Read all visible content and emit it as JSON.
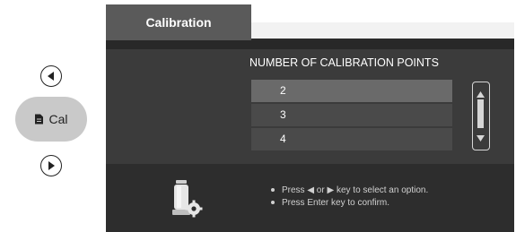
{
  "nav": {
    "prev_icon": "left-arrow-circle-icon",
    "mode_label": "Cal",
    "mode_icon": "document-icon",
    "next_icon": "right-arrow-circle-icon"
  },
  "screen": {
    "title": "Calibration",
    "question": "NUMBER OF CALIBRATION POINTS",
    "options": [
      "2",
      "3",
      "4"
    ],
    "selected_index": 0,
    "instructions": [
      "Press ◀ or ▶ key to select an option.",
      "Press Enter key to confirm."
    ],
    "device_icon": "probe-gear-icon"
  },
  "colors": {
    "screen_bg": "#282828",
    "selected_option": "#6a6a6a"
  }
}
